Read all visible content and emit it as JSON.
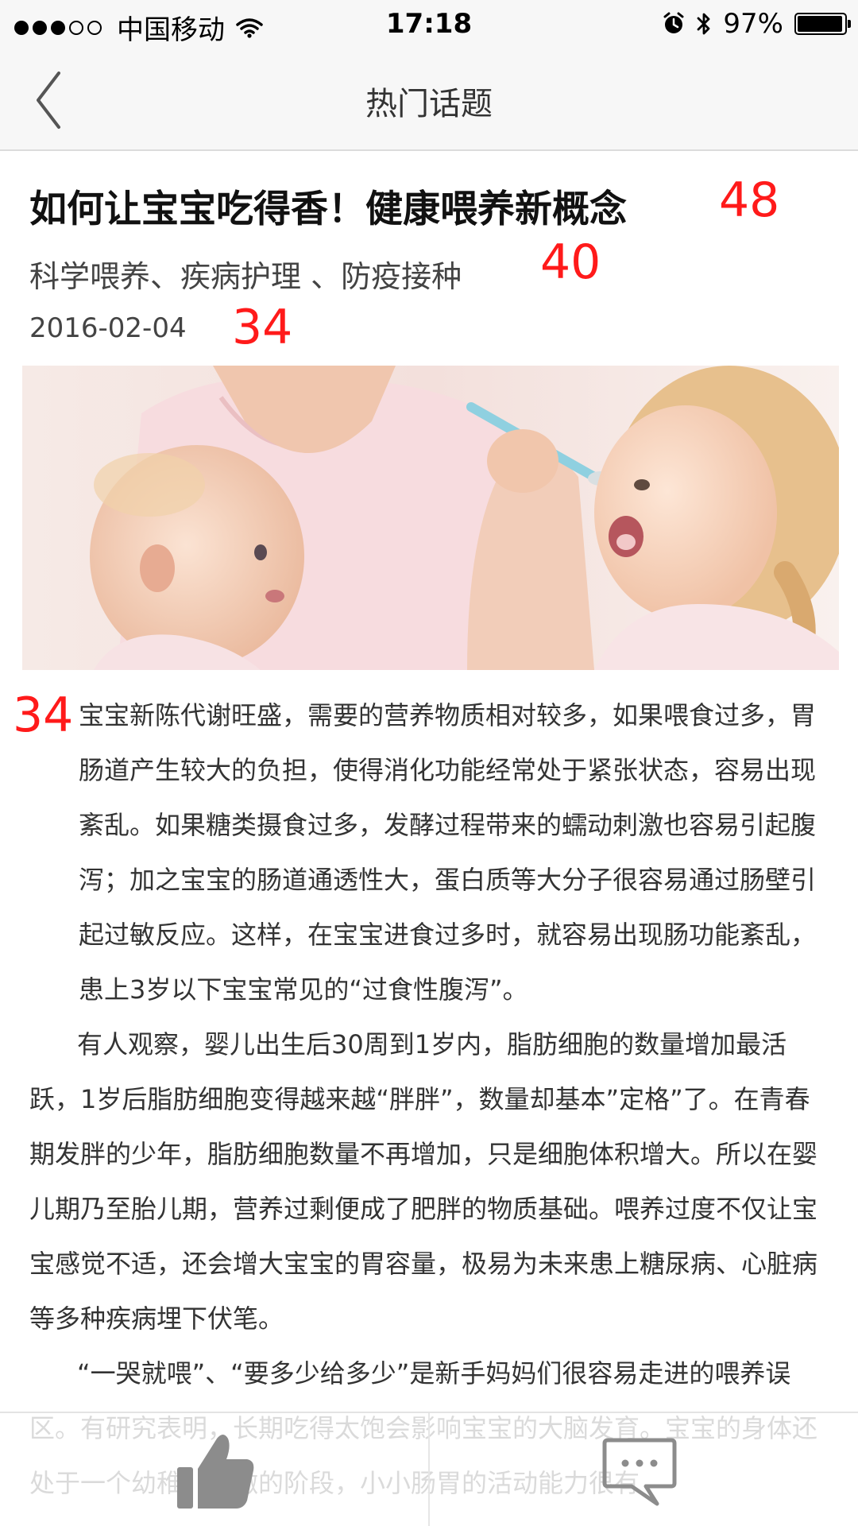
{
  "status_bar": {
    "carrier": "中国移动",
    "time": "17:18",
    "battery": "97%",
    "battery_level": 0.97,
    "signal_bars": 3,
    "signal_total": 5
  },
  "nav": {
    "title": "热门话题",
    "back_icon": "chevron-left-icon"
  },
  "article": {
    "title": "如何让宝宝吃得香！健康喂养新概念",
    "subtitle": "科学喂养、疾病护理 、防疫接种",
    "date": "2016-02-04",
    "paragraphs": [
      "宝宝新陈代谢旺盛，需要的营养物质相对较多，如果喂食过多，胃肠道产生较大的负担，使得消化功能经常处于紧张状态，容易出现紊乱。如果糖类摄食过多，发酵过程带来的蠕动刺激也容易引起腹泻；加之宝宝的肠道通透性大，蛋白质等大分子很容易通过肠壁引起过敏反应。这样，在宝宝进食过多时，就容易出现肠功能紊乱，患上3岁以下宝宝常见的“过食性腹泻”。",
      "有人观察，婴儿出生后30周到1岁内，脂肪细胞的数量增加最活跃，1岁后脂肪细胞变得越来越“胖胖”，数量却基本”定格”了。在青春期发胖的少年，脂肪细胞数量不再增加，只是细胞体积增大。所以在婴儿期乃至胎儿期，营养过剩便成了肥胖的物质基础。喂养过度不仅让宝宝感觉不适，还会增大宝宝的胃容量，极易为未来患上糖尿病、心脏病等多种疾病埋下伏笔。",
      "“一哭就喂”、“要多少给多少”是新手妈妈们很容易走进的喂养误区。有研究表明，长期吃得太饱会影响宝宝的大脑发育。宝宝的身体还处于一个幼稚、娇嫩的阶段，小小肠胃的活动能力很有"
    ]
  },
  "annotations": {
    "title_size": "48",
    "subtitle_size": "40",
    "date_size": "34",
    "body_size": "34"
  },
  "toolbar": {
    "like_icon": "thumbs-up-icon",
    "comment_icon": "comment-bubble-icon"
  },
  "colors": {
    "annotation": "#ff1a1a",
    "bar_bg": "#f7f7f7",
    "icon_gray": "#8c8c8c"
  }
}
